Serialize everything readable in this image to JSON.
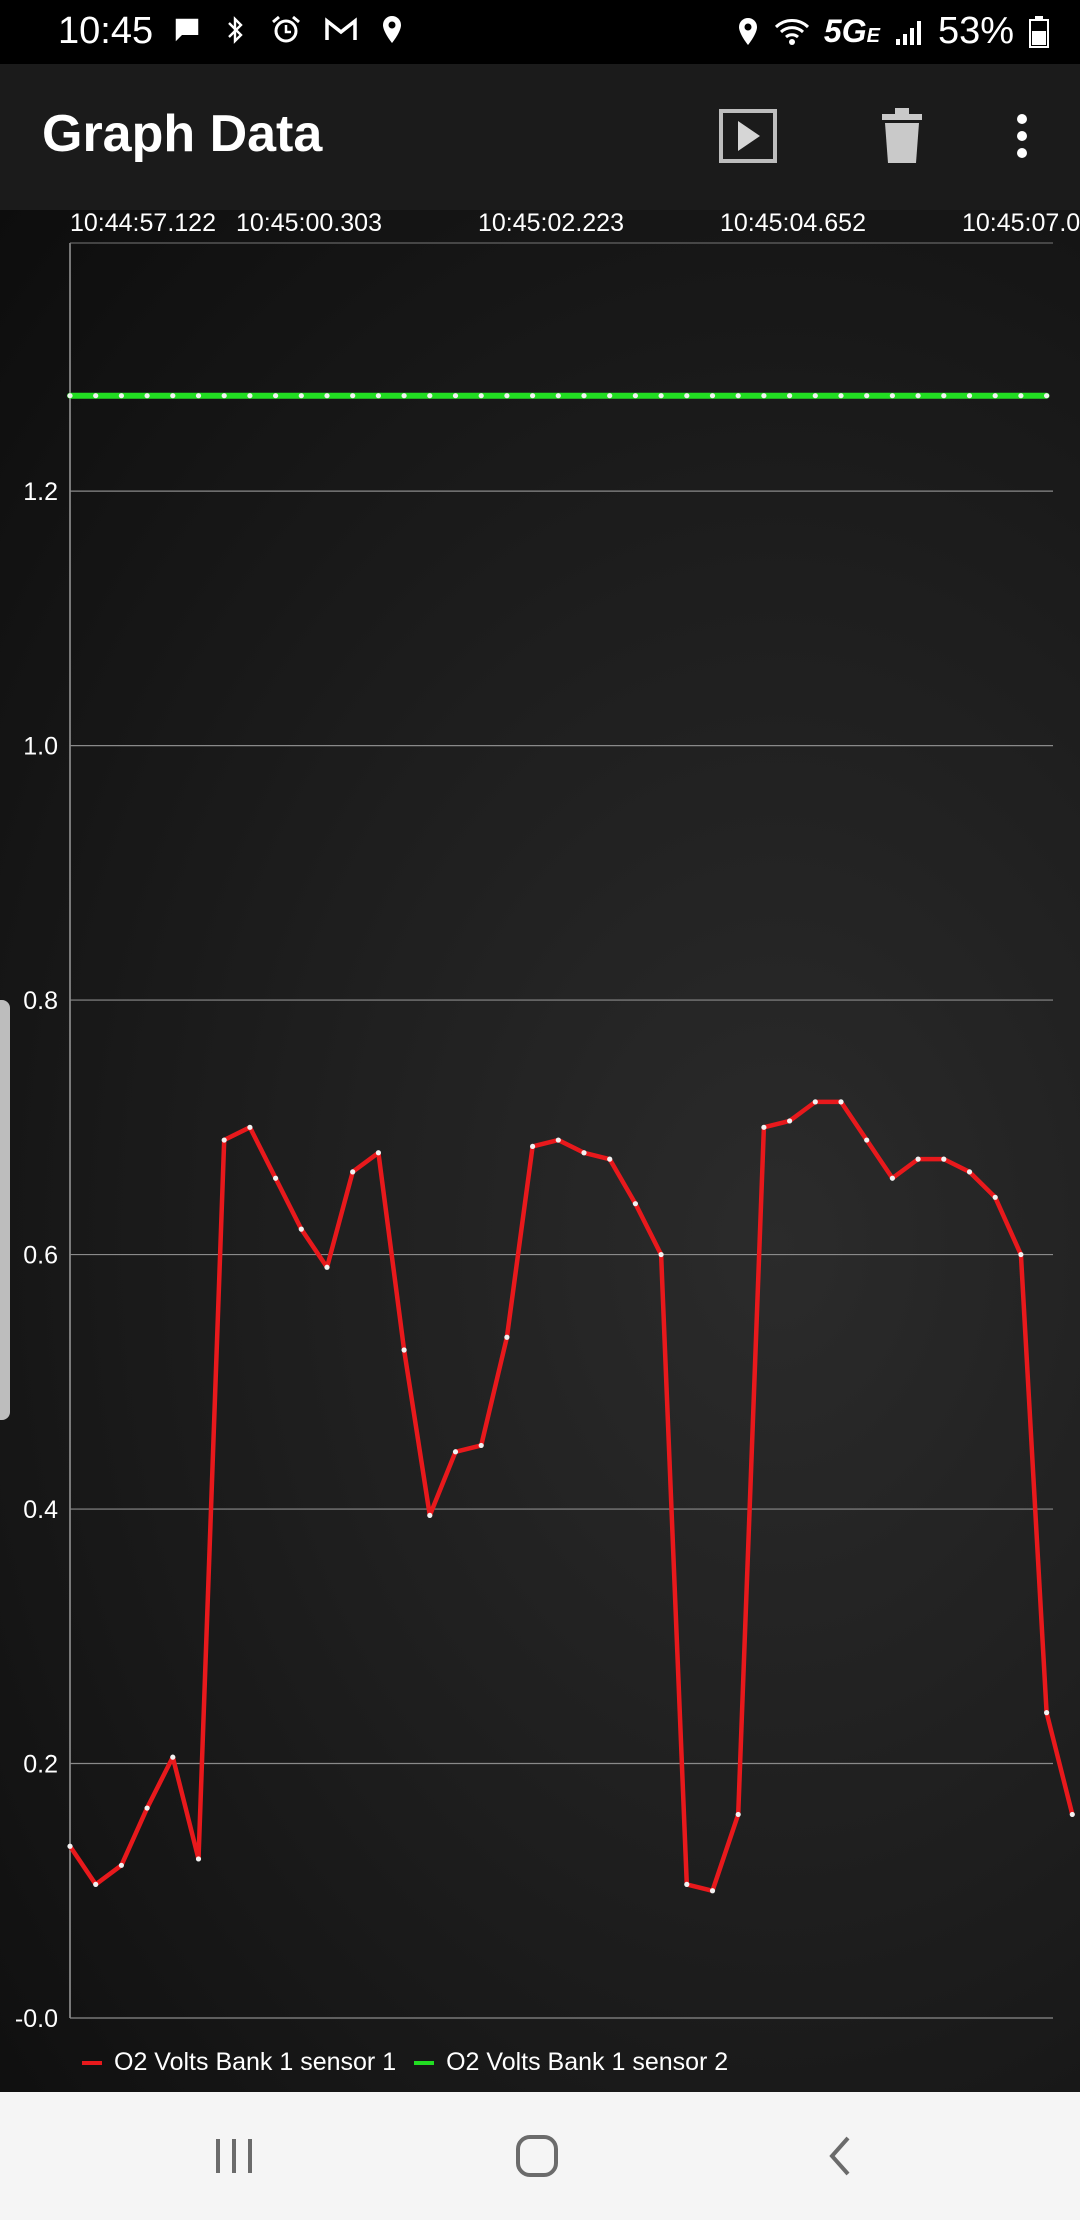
{
  "status_bar": {
    "time": "10:45",
    "network": "5G",
    "network_sub": "E",
    "battery_pct": "53%",
    "left_icons": [
      "message-icon",
      "bluetooth-icon",
      "alarm-icon",
      "gmail-icon",
      "location-icon"
    ],
    "right_icons": [
      "location-icon",
      "wifi-icon",
      "signal-icon",
      "battery-icon"
    ]
  },
  "app_bar": {
    "title": "Graph Data",
    "actions": [
      "play-icon",
      "trash-icon",
      "more-vert-icon"
    ]
  },
  "chart_data": {
    "type": "line",
    "title": "",
    "xlabel": "",
    "ylabel": "",
    "x_tick_labels": [
      "10:44:57.122",
      "10:45:00.303",
      "10:45:02.223",
      "10:45:04.652",
      "10:45:07.0"
    ],
    "y_tick_labels": [
      "1.2",
      "1.0",
      "0.8",
      "0.6",
      "0.4",
      "0.2",
      "-0.0"
    ],
    "ylim": [
      0.0,
      1.395
    ],
    "grid": true,
    "legend_position": "bottom-left",
    "series": [
      {
        "name": "O2 Volts Bank 1 sensor 1",
        "color": "#e8191c",
        "values": [
          0.135,
          0.105,
          0.12,
          0.165,
          0.205,
          0.125,
          0.69,
          0.7,
          0.66,
          0.62,
          0.59,
          0.665,
          0.68,
          0.525,
          0.395,
          0.445,
          0.45,
          0.535,
          0.685,
          0.69,
          0.68,
          0.675,
          0.64,
          0.6,
          0.105,
          0.1,
          0.16,
          0.7,
          0.705,
          0.72,
          0.72,
          0.69,
          0.66,
          0.675,
          0.675,
          0.665,
          0.645,
          0.6,
          0.24,
          0.16
        ]
      },
      {
        "name": "O2 Volts Bank 1 sensor 2",
        "color": "#22dd22",
        "values": [
          1.275,
          1.275,
          1.275,
          1.275,
          1.275,
          1.275,
          1.275,
          1.275,
          1.275,
          1.275,
          1.275,
          1.275,
          1.275,
          1.275,
          1.275,
          1.275,
          1.275,
          1.275,
          1.275,
          1.275,
          1.275,
          1.275,
          1.275,
          1.275,
          1.275,
          1.275,
          1.275,
          1.275,
          1.275,
          1.275,
          1.275,
          1.275,
          1.275,
          1.275,
          1.275,
          1.275,
          1.275,
          1.275,
          1.275
        ]
      }
    ]
  },
  "nav_bar": {
    "buttons": [
      "recent-apps-icon",
      "home-icon",
      "back-icon"
    ]
  }
}
